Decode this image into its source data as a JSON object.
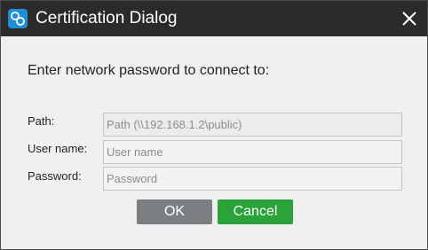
{
  "window": {
    "title": "Certification Dialog",
    "icon": "network-share-icon",
    "colors": {
      "titlebar": "#2b2b2b",
      "icon_bg": "#1f8fd6",
      "ok_button": "#7b7f82",
      "cancel_button": "#2aa33a"
    }
  },
  "prompt": "Enter network password to connect to:",
  "fields": {
    "path": {
      "label": "Path:",
      "value": "",
      "placeholder": "Path (\\\\192.168.1.2\\public)"
    },
    "username": {
      "label": "User name:",
      "value": "",
      "placeholder": "User name"
    },
    "password": {
      "label": "Password:",
      "value": "",
      "placeholder": "Password"
    }
  },
  "buttons": {
    "ok": "OK",
    "cancel": "Cancel"
  }
}
